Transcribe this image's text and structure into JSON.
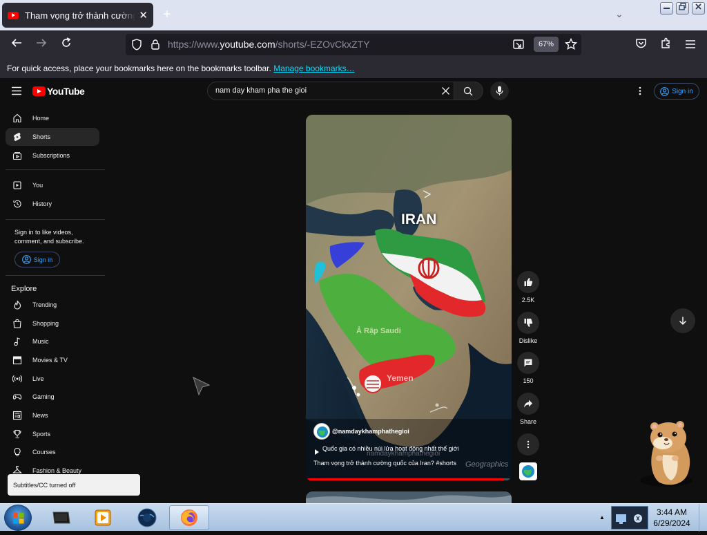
{
  "browser": {
    "tab_title": "Tham vọng trở thành cường quốc của Iran? #shorts",
    "new_tab": "+",
    "tab_close": "✕",
    "url_prefix": "https://www.",
    "url_host": "youtube.com",
    "url_path": "/shorts/-EZOvCkxZTY",
    "zoom": "67%",
    "bookmarks_msg": "For quick access, place your bookmarks here on the bookmarks toolbar.",
    "bookmarks_link": "Manage bookmarks…"
  },
  "youtube": {
    "logo_text": "YouTube",
    "search_value": "nam day kham pha the gioi",
    "signin_label": "Sign in",
    "sidebar": {
      "main": [
        "Home",
        "Shorts",
        "Subscriptions"
      ],
      "you": [
        "You",
        "History"
      ],
      "signin_prompt": "Sign in to like videos, comment, and subscribe.",
      "signin_label": "Sign in",
      "explore_heading": "Explore",
      "explore": [
        "Trending",
        "Shopping",
        "Music",
        "Movies & TV",
        "Live",
        "Gaming",
        "News",
        "Sports",
        "Courses",
        "Fashion & Beauty"
      ]
    },
    "video": {
      "map_label_iran": "IRAN",
      "map_label_saudi": "Ả Rập Saudi",
      "map_label_yemen": "Yemen",
      "watermark": "Geographics",
      "watermark_handle": "namdaykhamphathegioi",
      "channel": "@namdaykhamphathegioi",
      "related_title": "Quốc gia có nhiều núi lửa hoạt động nhất thế giới",
      "title": "Tham vọng trở thành cường quốc của Iran? #shorts"
    },
    "actions": {
      "likes": "2.5K",
      "dislike": "Dislike",
      "comments": "150",
      "share": "Share"
    },
    "toast": "Subtitles/CC turned off"
  },
  "taskbar": {
    "time": "3:44 AM",
    "date": "6/29/2024"
  },
  "colors": {
    "accent": "#3ea6ff",
    "yt_red": "#ff0000",
    "iran_green": "#2e9a42",
    "saudi_green": "#4caf3e",
    "yemen_red": "#e3282b"
  }
}
